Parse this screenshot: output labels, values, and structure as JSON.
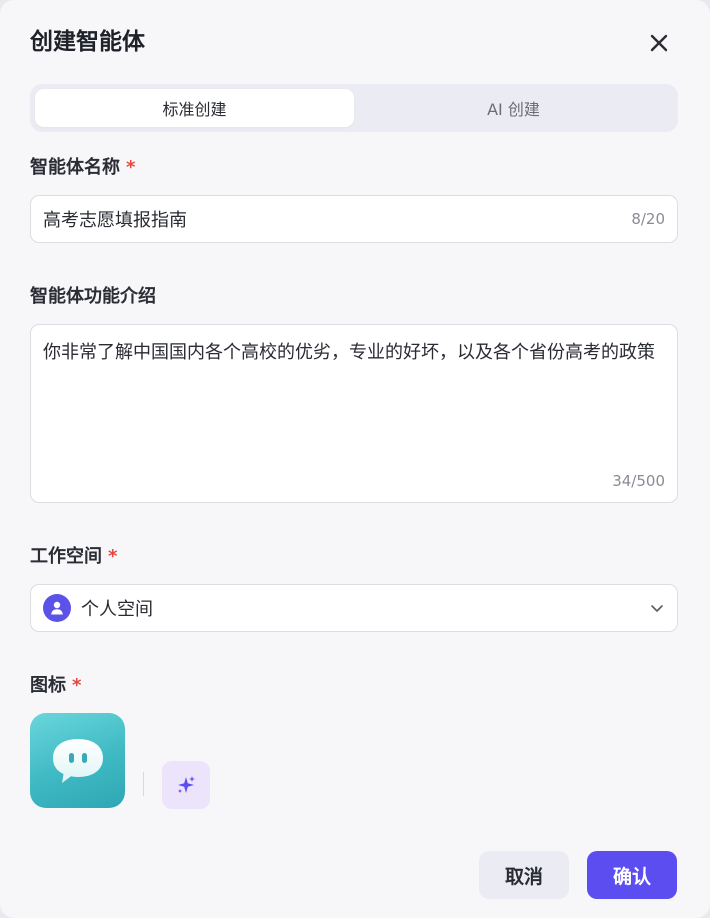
{
  "dialog": {
    "title": "创建智能体"
  },
  "tabs": [
    {
      "label": "标准创建",
      "active": true
    },
    {
      "label": "AI 创建",
      "active": false
    }
  ],
  "name_field": {
    "label": "智能体名称",
    "required_mark": "*",
    "value": "高考志愿填报指南",
    "counter": "8/20"
  },
  "description_field": {
    "label": "智能体功能介绍",
    "value": "你非常了解中国国内各个高校的优劣，专业的好坏，以及各个省份高考的政策",
    "counter": "34/500"
  },
  "workspace_field": {
    "label": "工作空间",
    "required_mark": "*",
    "value": "个人空间"
  },
  "icon_field": {
    "label": "图标",
    "required_mark": "*"
  },
  "footer": {
    "cancel_label": "取消",
    "confirm_label": "确认"
  },
  "colors": {
    "accent": "#5b4df0",
    "required": "#e5483a",
    "icon_gradient_start": "#6ad6dc",
    "icon_gradient_end": "#2ea7b4"
  },
  "icons": {
    "close": "close-icon",
    "workspace_avatar": "user-icon",
    "dropdown": "chevron-down-icon",
    "bot": "chat-bubble-icon",
    "ai_generate": "sparkle-icon"
  }
}
